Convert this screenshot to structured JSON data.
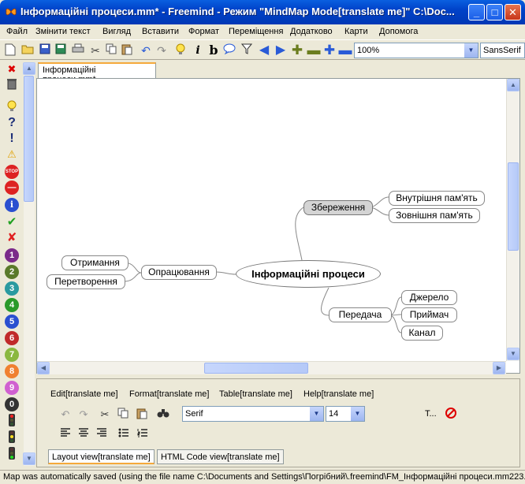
{
  "window": {
    "title": "Інформаційні процеси.mm* - Freemind - Режим \"MindMap Mode[translate me]\" C:\\Doc...",
    "minimize": "_",
    "maximize": "□",
    "close": "✕"
  },
  "menubar": {
    "items": [
      "Файл",
      "Змінити текст",
      "Вигляд",
      "Вставити",
      "Формат",
      "Переміщення",
      "Додатково",
      "Карти",
      "Допомога"
    ]
  },
  "toolbar": {
    "zoom_value": "100%",
    "font_value": "SansSerif",
    "icons": [
      "new-icon",
      "open-icon",
      "save-icon",
      "save-as-icon",
      "print-icon",
      "cut-icon",
      "copy-icon",
      "paste-icon",
      "undo-icon",
      "redo-icon",
      "idea-icon",
      "italic-icon",
      "bold-icon",
      "cloud-icon",
      "filter-icon",
      "back-icon",
      "forward-icon",
      "zoom-in-icon",
      "zoom-out-icon",
      "expand-icon",
      "collapse-icon"
    ]
  },
  "document_tab": {
    "label": "Інформаційні процеси.mm*"
  },
  "mindmap": {
    "root": "Інформаційні процеси",
    "nodes": {
      "storage": "Збереження",
      "internal_memory": "Внутрішня пам'ять",
      "external_memory": "Зовнішня пам'ять",
      "processing": "Опрацювання",
      "receiving": "Отримання",
      "transformation": "Перетворення",
      "transmission": "Передача",
      "source": "Джерело",
      "receiver": "Приймач",
      "channel": "Канал"
    }
  },
  "editor": {
    "menu": [
      "Edit[translate me]",
      "Format[translate me]",
      "Table[translate me]",
      "Help[translate me]"
    ],
    "font_value": "Serif",
    "size_value": "14",
    "text_color_label": "T...",
    "tabs": [
      "Layout view[translate me]",
      "HTML Code view[translate me]"
    ]
  },
  "status": {
    "text": "Map was automatically saved (using the file name C:\\Documents and Settings\\Погрібний\\.freemind\\FM_Інформаційні процеси.mm223..."
  }
}
